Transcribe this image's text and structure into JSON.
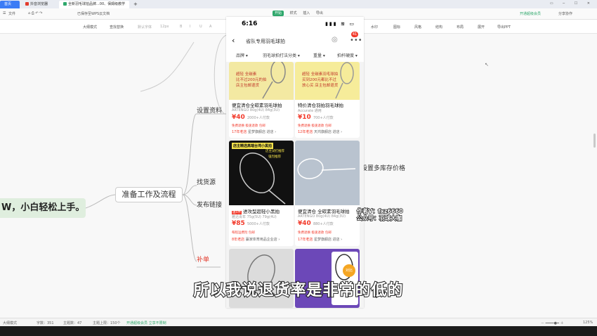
{
  "tabs": [
    {
      "label": "首页"
    },
    {
      "label": "抖音浏览器"
    },
    {
      "label": "全新羽毛球拍品牌...00、保姆级教学"
    }
  ],
  "menu": {
    "file": "文件",
    "tabs": [
      "开始",
      "样式",
      "插入",
      "导出"
    ],
    "right": [
      "开通超级会员",
      "分享协作"
    ],
    "save_status": "已保存至WPS云文档"
  },
  "toolbar": {
    "items": [
      "大纲模式",
      "查找替换",
      "默认字体",
      "12px",
      "B",
      "I",
      "U",
      "A",
      "水印",
      "图标",
      "风格",
      "结构",
      "布局",
      "展开",
      "导出PPT"
    ]
  },
  "mindmap": {
    "root": "准备工作及流程",
    "left_node": "W，小白轻松上手。",
    "branches": [
      "设置资料",
      "找货源",
      "发布链接",
      "补单"
    ],
    "right_label": "设置多库存价格"
  },
  "phone": {
    "time": "6:16",
    "status_icons": "▮▮▮ ≋ ▭",
    "search_query": "省队专用羽毛球拍",
    "badge": "41",
    "filters": [
      "品牌 ▾",
      "羽毛球拍打法分类 ▾",
      "重量 ▾",
      "拍杆硬度 ▾"
    ],
    "cards": [
      {
        "img_lines": [
          "超轻 全碳素",
          "比不过200元的拍",
          "店主包邮退货"
        ],
        "title": "便宜清仓全碳素羽毛球拍",
        "sub": "ARTENGO 80g(4U) 84g(3U)",
        "price": "40",
        "sold": "2000+人付款",
        "tags": "免费退换  极速退款  包邮",
        "shop_year": "17年老店",
        "shop": "星梦旗舰店 进店 ›"
      },
      {
        "img_lines": [
          "超轻 全碳素羽毛球拍",
          "买到200元都比不过",
          "放心买 店主包邮退货"
        ],
        "title": "特价清仓羽拍羽毛球拍",
        "sub": "Accurate  通用",
        "price": "10",
        "sold": "700+人付款",
        "tags": "免费退换  极速退款  包邮",
        "shop_year": "12年老店",
        "shop": "天鸿旗舰店 进店 ›"
      },
      {
        "img_lines": [
          "店主精选高端台湾小黑拍",
          "店主试打推荐",
          "强烈推荐"
        ],
        "title": "进攻型超轻小黑拍",
        "sub": "雅迅青年  75g(5U)  79g(4U)",
        "price": "85",
        "sold": "5000+人付款",
        "tags": "每程运费险  包邮",
        "shop_year": "8年老店",
        "shop": "赢家体育用品企业店 ›"
      },
      {
        "img_lines": [],
        "title": "便宜清仓 全碳素羽毛球拍",
        "sub": "ARTENGO 80g(4U) 84g(3U)",
        "price": "40",
        "sold": "880+人付款",
        "tags": "免费退换  极速退款  包邮",
        "shop_year": "17年老店",
        "shop": "星梦旗舰店 进店 ›"
      }
    ],
    "compare_label": "对比"
  },
  "status": {
    "mode": "大纲模式",
    "words": "字数：351",
    "topics": "主题数：47",
    "topic_limit": "主题上限：150个",
    "promo": "开通超级会员 立享不限制",
    "zoom": "125%"
  },
  "caption": "所以我说退货率是非常的低的",
  "watermark": [
    "作者V：fxz6660",
    "公众号：羽球大咖"
  ]
}
